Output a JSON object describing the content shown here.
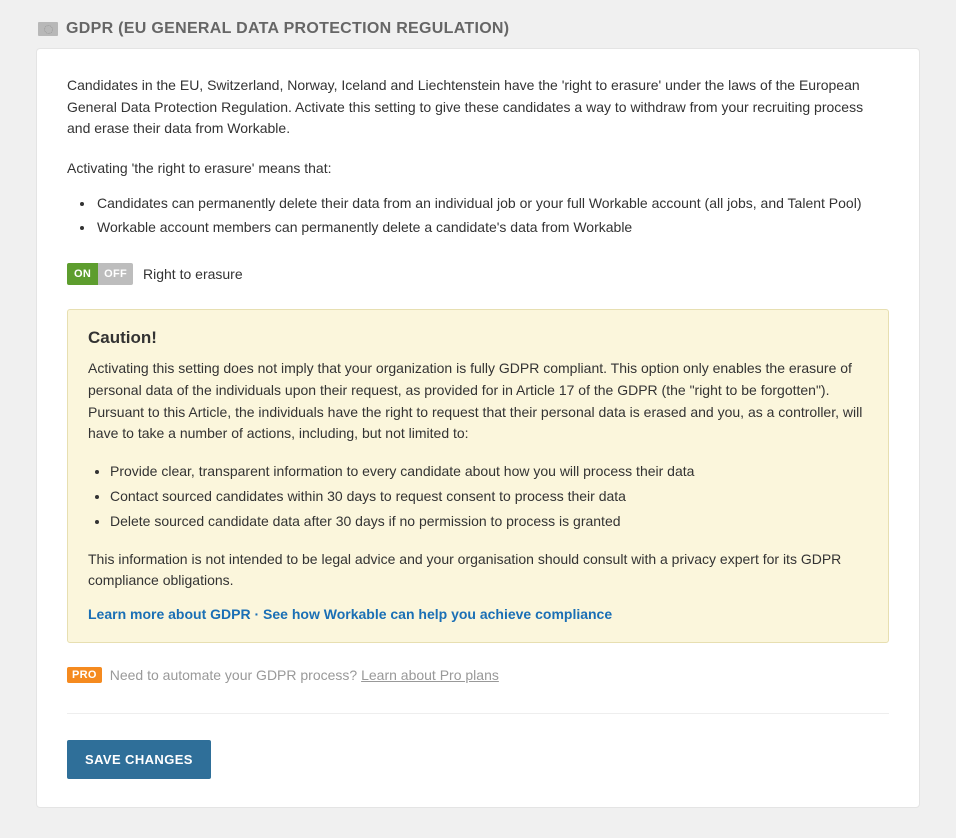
{
  "header": {
    "title": "GDPR (EU GENERAL DATA PROTECTION REGULATION)"
  },
  "content": {
    "intro": "Candidates in the EU, Switzerland, Norway, Iceland and Liechtenstein have the 'right to erasure' under the laws of the European General Data Protection Regulation. Activate this setting to give these candidates a way to withdraw from your recruiting process and erase their data from Workable.",
    "meaning_intro": "Activating 'the right to erasure' means that:",
    "meaning_points": [
      "Candidates can permanently delete their data from an individual job or your full Workable account (all jobs, and Talent Pool)",
      "Workable account members can permanently delete a candidate's data from Workable"
    ]
  },
  "toggle": {
    "on": "ON",
    "off": "OFF",
    "label": "Right to erasure",
    "state": "on"
  },
  "caution": {
    "title": "Caution!",
    "body": "Activating this setting does not imply that your organization is fully GDPR compliant. This option only enables the erasure of personal data of the individuals upon their request, as provided for in Article 17 of the GDPR (the \"right to be forgotten\"). Pursuant to this Article, the individuals have the right to request that their personal data is erased and you, as a controller, will have to take a number of actions, including, but not limited to:",
    "points": [
      "Provide clear, transparent information to every candidate about how you will process their data",
      "Contact sourced candidates within 30 days to request consent to process their data",
      "Delete sourced candidate data after 30 days if no permission to process is granted"
    ],
    "footer": "This information is not intended to be legal advice and your organisation should consult with a privacy expert for its GDPR compliance obligations.",
    "link1": "Learn more about GDPR",
    "sep": " · ",
    "link2": "See how Workable can help you achieve compliance"
  },
  "pro": {
    "badge": "PRO",
    "text": "Need to automate your GDPR process? ",
    "link": "Learn about Pro plans"
  },
  "actions": {
    "save": "SAVE CHANGES"
  }
}
